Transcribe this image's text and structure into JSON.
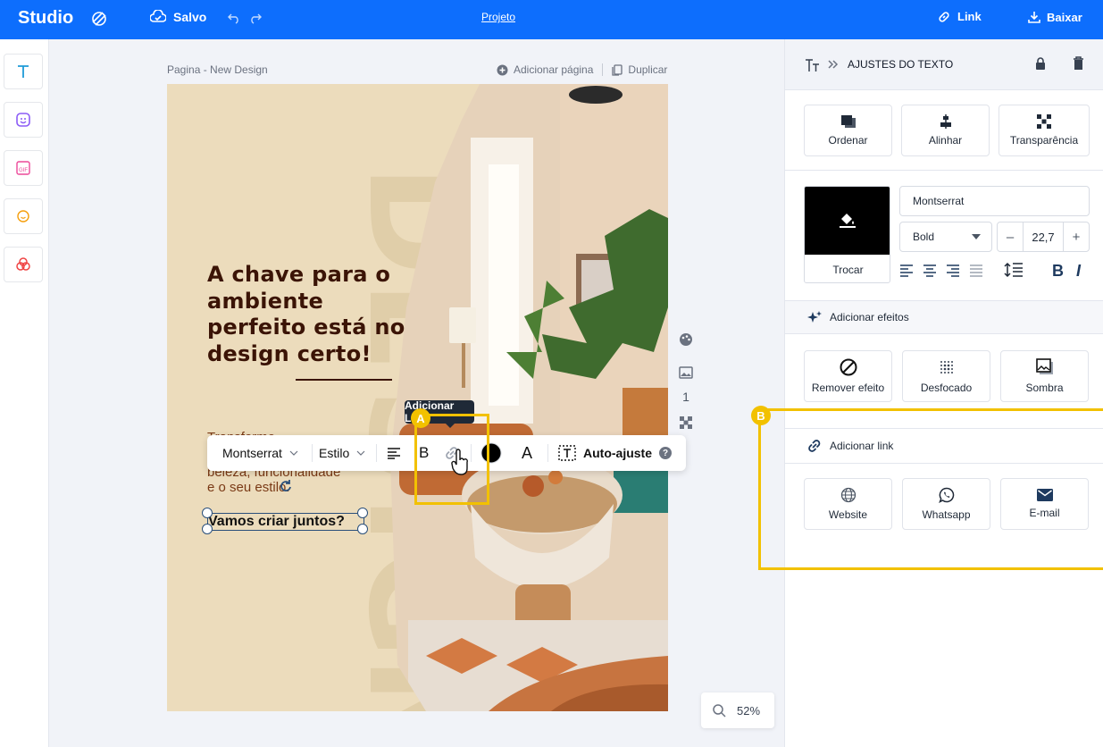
{
  "topbar": {
    "brand": "Studio",
    "save_status": "Salvo",
    "project": "Projeto",
    "link_label": "Link",
    "download_label": "Baixar"
  },
  "leftrail": {
    "icons": [
      "text-icon",
      "sticker-icon",
      "gif-icon",
      "emoji-icon",
      "shapes-icon"
    ]
  },
  "canvas": {
    "page_label": "Pagina - New Design",
    "add_page": "Adicionar página",
    "duplicate": "Duplicar",
    "page_number": "1",
    "zoom": "52%"
  },
  "design": {
    "headline": "A chave para o ambiente perfeito está no design certo!",
    "body_line1": "Transforme",
    "body_line2": "beleza, funcionalidade",
    "body_line3": "e o seu estilo.",
    "cta": "Vamos criar juntos?",
    "watermark_letters": [
      "D",
      "E",
      "S",
      "I",
      "G",
      "N"
    ]
  },
  "toolbar": {
    "font": "Montserrat",
    "style": "Estilo",
    "bold": "B",
    "text_color_letter": "A",
    "auto_fit": "Auto-ajuste",
    "help": "?",
    "tooltip": "Adicionar Link"
  },
  "annotations": {
    "a": "A",
    "b": "B"
  },
  "panel": {
    "title": "AJUSTES DO TEXTO",
    "order": "Ordenar",
    "align": "Alinhar",
    "transparency": "Transparência",
    "swap": "Trocar",
    "font": "Montserrat",
    "weight": "Bold",
    "size": "22,7",
    "minus": "–",
    "plus": "+",
    "bold": "B",
    "italic": "I",
    "effects_section": "Adicionar efeitos",
    "remove_effect": "Remover efeito",
    "blur": "Desfocado",
    "shadow": "Sombra",
    "link_section": "Adicionar link",
    "website": "Website",
    "whatsapp": "Whatsapp",
    "email": "E-mail"
  },
  "colors": {
    "accent": "#0d6efd",
    "highlight": "#f2c100",
    "headline": "#3b1406",
    "text_color": "#000000"
  }
}
